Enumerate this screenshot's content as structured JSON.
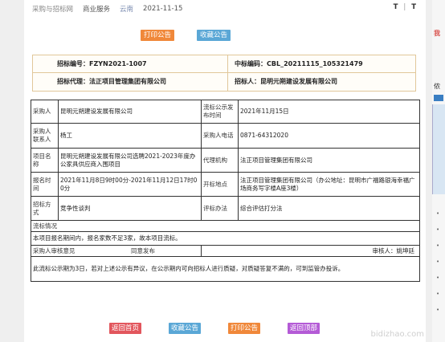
{
  "breadcrumb": {
    "site": "采购与招标网",
    "section": "商业服务",
    "region": "云南",
    "date": "2021-11-15",
    "text_large": "T",
    "text_small": "T"
  },
  "top_actions": {
    "print": "打印公告",
    "collect": "收藏公告"
  },
  "info": {
    "bid_no_label": "招标编号：",
    "bid_no": "FZYN2021-1007",
    "award_no_label": "中标编码：",
    "award_no": "CBL_20211115_105321479",
    "agent_label": "招标代理：",
    "agent": "法正项目管理集团有限公司",
    "tenderee_label": "招标人：",
    "tenderee": "昆明元朔建设发展有限公司"
  },
  "table": {
    "purchaser_label": "采购人",
    "purchaser": "昆明元朔建设发展有限公司",
    "failed_date_label": "流标公示发布时间",
    "failed_date": "2021年11月15日",
    "contact_label": "采购人联系人",
    "contact": "杨工",
    "phone_label": "采购人电话",
    "phone": "0871-64312020",
    "project_label": "项目名称",
    "project": "昆明元朔建设发展有限公司选聘2021-2023年度办公家具供应商入围项目",
    "agency_label": "代理机构",
    "agency": "法正项目管理集团有限公司",
    "signup_label": "报名时间",
    "signup": "2021年11月8日9时00分-2021年11月12日17时00分",
    "bid_place_label": "开标地点",
    "bid_place": "法正项目管理集团有限公司（办公地址：昆明市广福路银海幸福广场商务写字楼A座3楼）",
    "method_label": "招标方式",
    "method": "竞争性谈判",
    "eval_label": "评标办法",
    "eval": "综合评估打分法",
    "failure_title": "流标情况",
    "failure_text": "本项目报名期间内，报名家数不足3家，故本项目流标。",
    "review_label": "采购人审核意见",
    "review_value": "同意发布",
    "reviewer": "审核人：姚坤廷",
    "notice_text": "此流标公示期为3日，若对上述公示有异议，在公示期内可向招标人进行质疑，对质疑答复不满的，可到监管办投诉。"
  },
  "bottom_actions": {
    "home": "返回首页",
    "collect": "收藏公告",
    "print": "打印公告",
    "top": "返回顶部"
  },
  "side": {
    "text1": "我",
    "text2": "侬"
  },
  "watermark": "bidizhao.com",
  "colors": {
    "orange": "#f0883a",
    "blue": "#5aa7d6",
    "red": "#e2565d",
    "purple": "#b45bd6",
    "info_border": "#e1c79a"
  }
}
